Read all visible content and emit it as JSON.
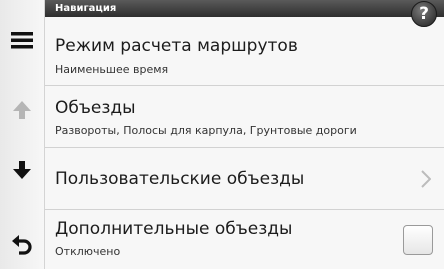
{
  "header": {
    "title": "Навигация",
    "help_label": "?"
  },
  "sidebar": {
    "buttons": [
      {
        "name": "menu-icon"
      },
      {
        "name": "scroll-up-icon",
        "state": "disabled"
      },
      {
        "name": "scroll-down-icon"
      },
      {
        "name": "back-icon"
      }
    ]
  },
  "items": [
    {
      "title": "Режим расчета маршрутов",
      "subtitle": "Наименьшее время"
    },
    {
      "title": "Объезды",
      "subtitle": "Развороты, Полосы для карпула, Грунтовые дороги"
    },
    {
      "title": "Пользовательские объезды",
      "control": "chevron-right-icon"
    },
    {
      "title": "Дополнительные объезды",
      "subtitle": "Отключено",
      "control": "checkbox",
      "checked": false
    }
  ],
  "colors": {
    "header_bg": "#3a3a3a",
    "panel_bg": "#f7f7f7",
    "sidebar_bg": "#eeeeee",
    "disabled_icon": "#b5b5b5"
  }
}
